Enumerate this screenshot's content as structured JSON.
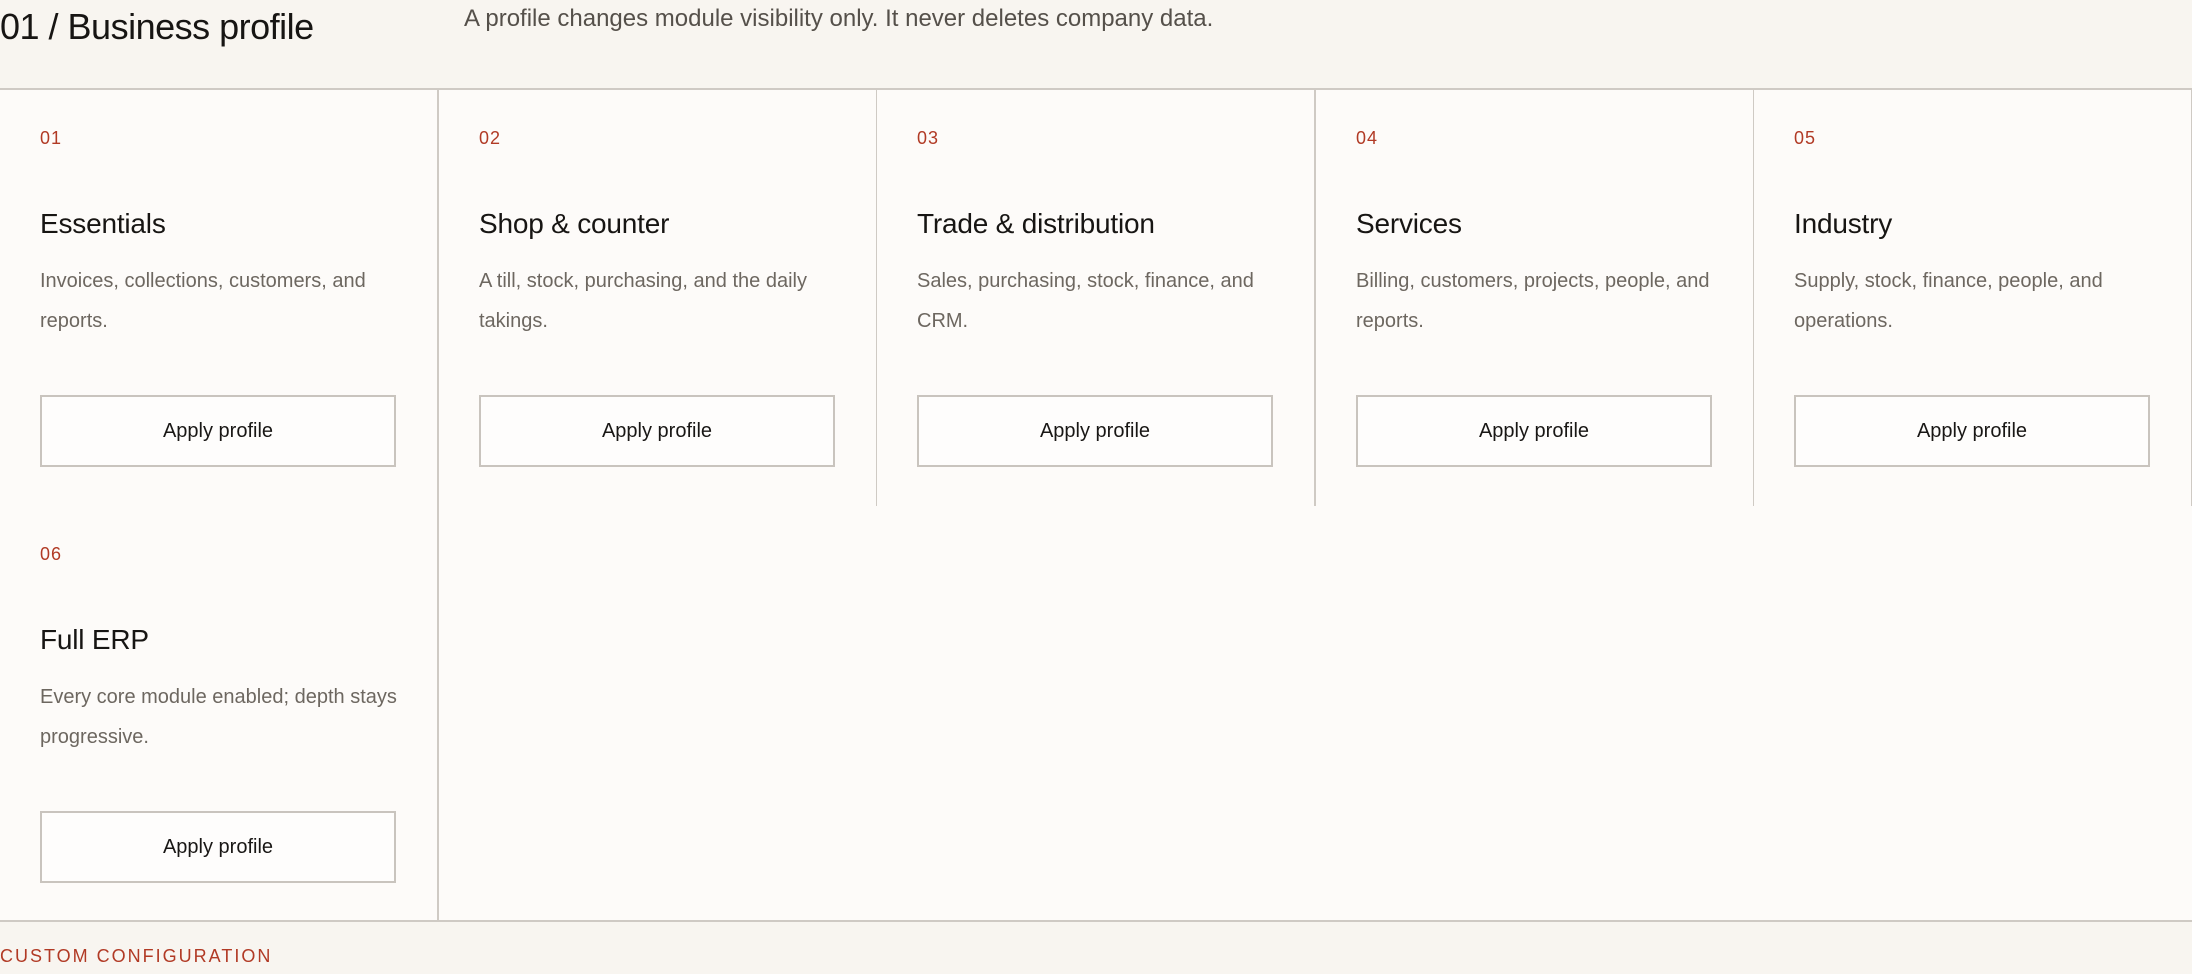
{
  "header": {
    "title": "01 / Business profile",
    "note": "A profile changes module visibility only. It never deletes company data."
  },
  "profiles": [
    {
      "number": "01",
      "title": "Essentials",
      "description": "Invoices, collections, customers, and reports.",
      "button_label": "Apply profile"
    },
    {
      "number": "02",
      "title": "Shop & counter",
      "description": "A till, stock, purchasing, and the daily takings.",
      "button_label": "Apply profile"
    },
    {
      "number": "03",
      "title": "Trade & distribution",
      "description": "Sales, purchasing, stock, finance, and CRM.",
      "button_label": "Apply profile"
    },
    {
      "number": "04",
      "title": "Services",
      "description": "Billing, customers, projects, people, and reports.",
      "button_label": "Apply profile"
    },
    {
      "number": "05",
      "title": "Industry",
      "description": "Supply, stock, finance, people, and operations.",
      "button_label": "Apply profile"
    },
    {
      "number": "06",
      "title": "Full ERP",
      "description": "Every core module enabled; depth stays progressive.",
      "button_label": "Apply profile"
    }
  ],
  "footer": {
    "section_label": "CUSTOM CONFIGURATION"
  },
  "colors": {
    "accent": "#b13a25",
    "background": "#f8f5f0",
    "card_background": "#fdfbf9",
    "border": "#cfcac4"
  }
}
